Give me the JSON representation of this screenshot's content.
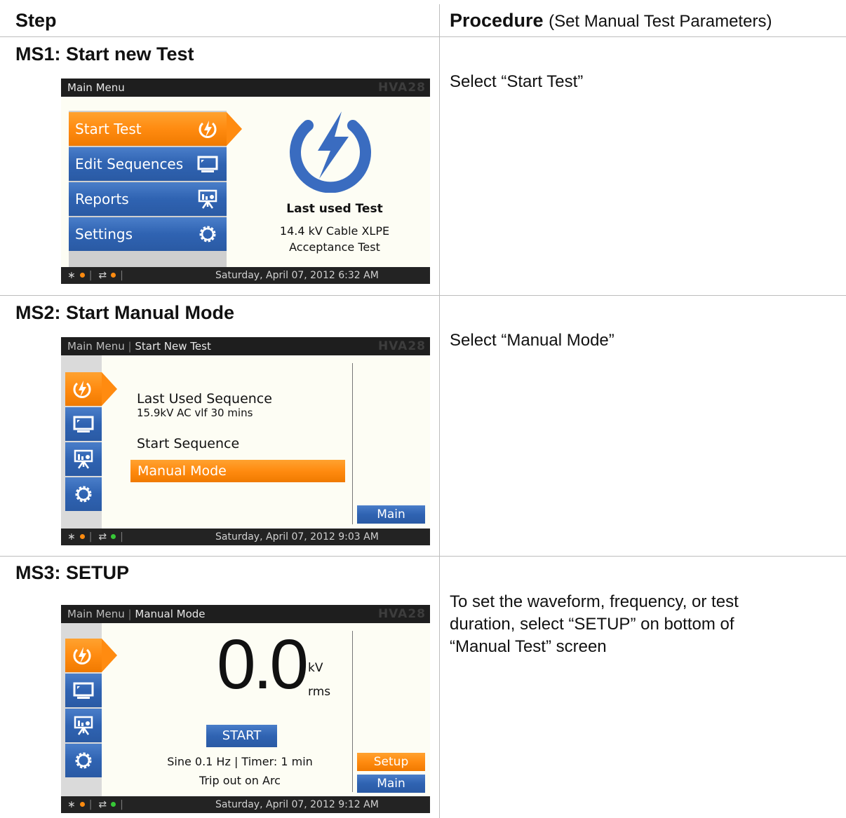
{
  "header": {
    "step": "Step",
    "procedure_bold": "Procedure",
    "procedure_note": "(Set Manual Test Parameters)"
  },
  "rows": [
    {
      "title": "MS1: Start new Test",
      "procedure": "Select “Start Test”"
    },
    {
      "title": "MS2: Start Manual Mode",
      "procedure": "Select “Manual Mode”"
    },
    {
      "title": "MS3: SETUP",
      "procedure": "To set the waveform, frequency, or test duration, select “SETUP” on bottom of “Manual Test” screen"
    }
  ],
  "brand": "HVA28",
  "screen1": {
    "title": "Main Menu",
    "menu": [
      "Start Test",
      "Edit Sequences",
      "Reports",
      "Settings"
    ],
    "last_used_label": "Last used Test",
    "last_used_line1": "14.4 kV Cable XLPE",
    "last_used_line2": "Acceptance Test",
    "datetime": "Saturday, April 07, 2012 6:32 AM"
  },
  "screen2": {
    "breadcrumb_1": "Main Menu",
    "breadcrumb_2": "Start New Test",
    "last_seq_label": "Last Used Sequence",
    "last_seq_value": "15.9kV AC vlf 30 mins",
    "start_sequence": "Start Sequence",
    "manual_mode": "Manual Mode",
    "main_btn": "Main",
    "datetime": "Saturday, April 07, 2012 9:03 AM"
  },
  "screen3": {
    "breadcrumb_1": "Main Menu",
    "breadcrumb_2": "Manual Mode",
    "voltage": "0.0",
    "unit_top": "kV",
    "unit_bottom": "rms",
    "start_btn": "START",
    "info_line1": "Sine 0.1 Hz | Timer:  1 min",
    "info_line2": "Trip out on Arc",
    "setup_btn": "Setup",
    "main_btn": "Main",
    "datetime": "Saturday, April 07, 2012 9:12 AM"
  },
  "colors": {
    "orange": "#ff8b10",
    "blue": "#2f63b2",
    "titlebar": "#1e1e1e"
  },
  "icons": [
    "bolt-icon",
    "monitor-icon",
    "presentation-icon",
    "gear-icon",
    "bluetooth-icon",
    "usb-icon"
  ]
}
